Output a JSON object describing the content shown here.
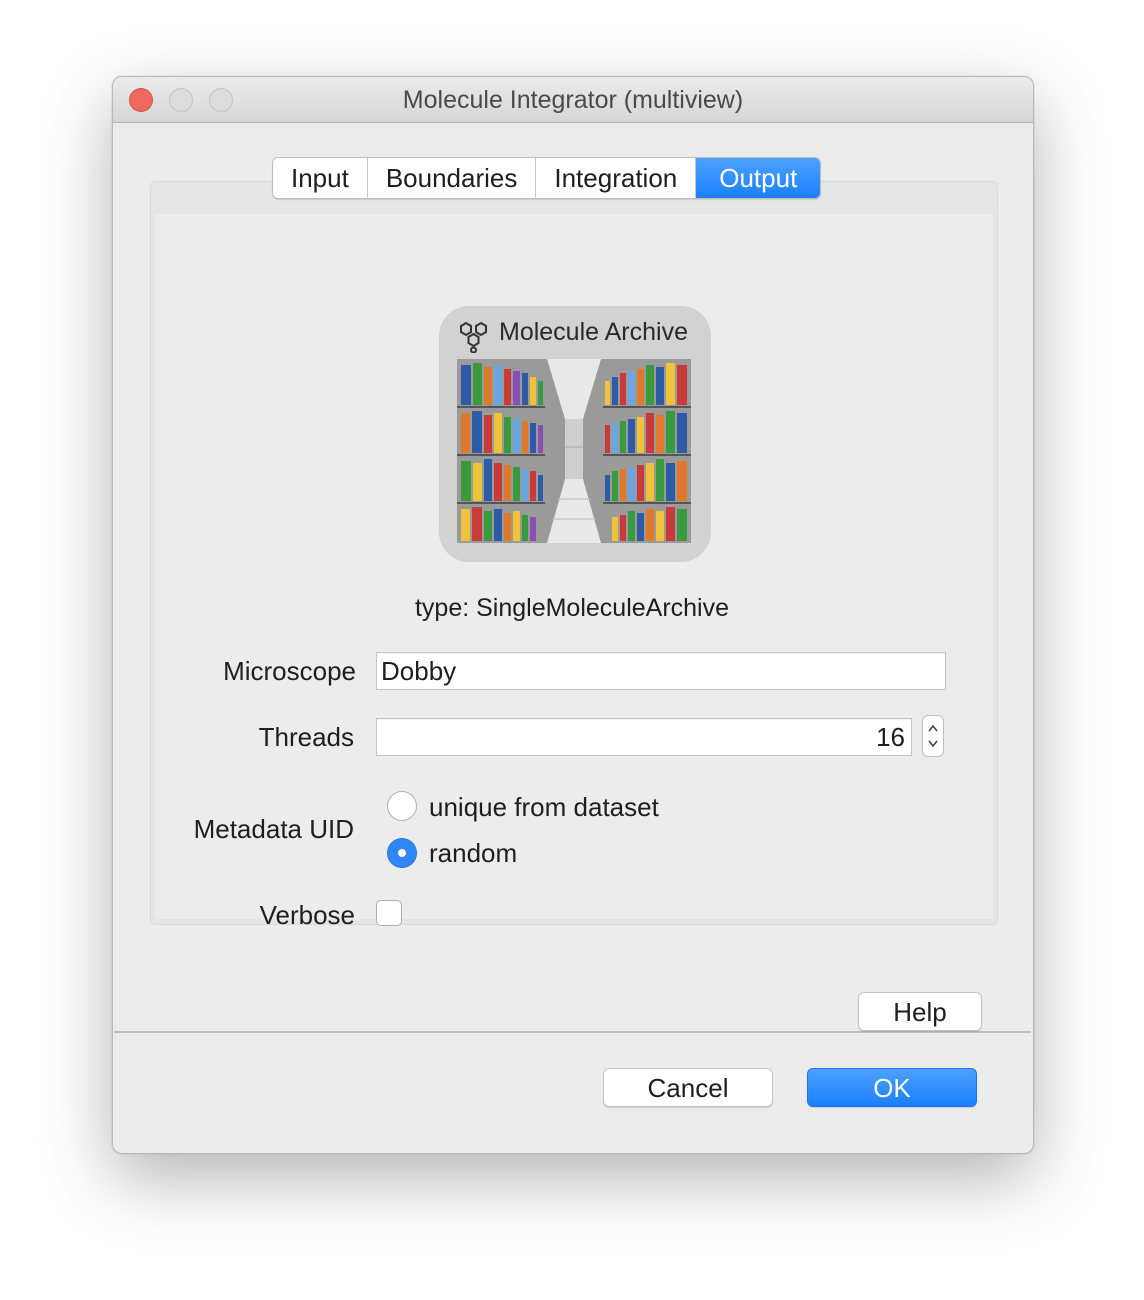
{
  "window": {
    "title": "Molecule Integrator (multiview)"
  },
  "tabs": [
    {
      "label": "Input",
      "active": false
    },
    {
      "label": "Boundaries",
      "active": false
    },
    {
      "label": "Integration",
      "active": false
    },
    {
      "label": "Output",
      "active": true
    }
  ],
  "logo": {
    "title": "Molecule Archive",
    "image": "molecule-archive-bookshelves",
    "icon": "molecule-icon"
  },
  "type_label": "type: SingleMoleculeArchive",
  "fields": {
    "microscope": {
      "label": "Microscope",
      "value": "Dobby"
    },
    "threads": {
      "label": "Threads",
      "value": "16"
    },
    "metadata_uid": {
      "label": "Metadata UID",
      "options": [
        "unique from dataset",
        "random"
      ],
      "selected": "random"
    },
    "verbose": {
      "label": "Verbose",
      "checked": false
    }
  },
  "buttons": {
    "help": "Help",
    "cancel": "Cancel",
    "ok": "OK"
  },
  "colors": {
    "accent": "#1a7fff",
    "close": "#ee6a5e"
  }
}
